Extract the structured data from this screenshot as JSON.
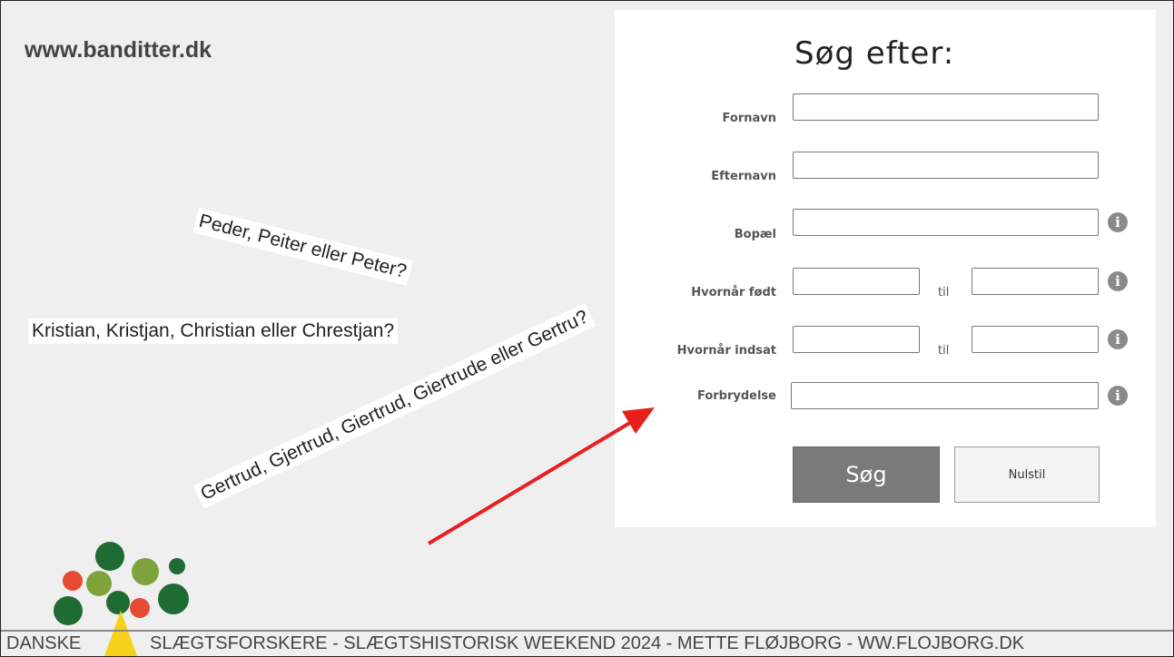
{
  "site": {
    "url": "www.banditter.dk"
  },
  "form": {
    "title": "Søg efter:",
    "fields": {
      "fornavn": {
        "label": "Fornavn",
        "value": ""
      },
      "efternavn": {
        "label": "Efternavn",
        "value": ""
      },
      "bopael": {
        "label": "Bopæl",
        "value": ""
      },
      "foedt": {
        "label": "Hvornår født",
        "til": "til",
        "from_value": "",
        "to_value": ""
      },
      "indsat": {
        "label": "Hvornår indsat",
        "til": "til",
        "from_value": "",
        "to_value": ""
      },
      "forbrydelse": {
        "label": "Forbrydelse",
        "value": ""
      }
    },
    "info_icon_glyph": "i",
    "search_button": "Søg",
    "reset_button": "Nulstil"
  },
  "callouts": {
    "peder": "Peder, Peiter eller Peter?",
    "kristian": "Kristian, Kristjan, Christian eller Chrestjan?",
    "gertrud": "Gertrud, Gjertrud, Giertrud, Giertrude eller Gertru?"
  },
  "footer": {
    "left": "DANSKE",
    "right": "SLÆGTSFORSKERE - SLÆGTSHISTORISK WEEKEND 2024 - METTE FLØJBORG  - WW.FLOJBORG.DK"
  },
  "colors": {
    "arrow": "#e8201c",
    "logo_dark_green": "#1f6b34",
    "logo_olive": "#7fa33c",
    "logo_red": "#e64a32",
    "logo_yellow": "#f6d31a",
    "search_button_bg": "#7a7a7a"
  }
}
